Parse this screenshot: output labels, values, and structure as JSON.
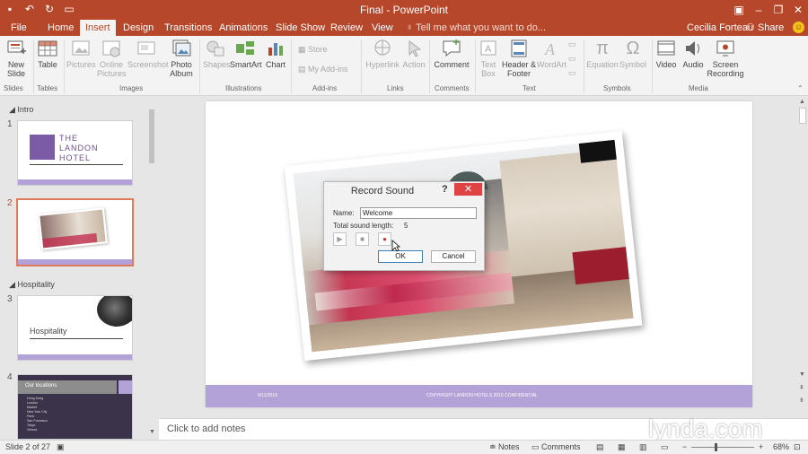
{
  "window": {
    "title": "Final  -  PowerPoint",
    "qat": [
      "save-icon",
      "undo-icon",
      "redo-icon",
      "present-icon"
    ]
  },
  "tabs": {
    "items": [
      "File",
      "Home",
      "Insert",
      "Design",
      "Transitions",
      "Animations",
      "Slide Show",
      "Review",
      "View"
    ],
    "active": "Insert",
    "tell_me": "Tell me what you want to do...",
    "user": "Cecilia Forteau",
    "share": "Share"
  },
  "ribbon": {
    "new_slide": "New Slide",
    "table": "Table",
    "pictures": "Pictures",
    "online_pictures": "Online Pictures",
    "screenshot": "Screenshot",
    "photo_album": "Photo Album",
    "shapes": "Shapes",
    "smartart": "SmartArt",
    "chart": "Chart",
    "store": "Store",
    "my_addins": "My Add-ins",
    "hyperlink": "Hyperlink",
    "action": "Action",
    "comment": "Comment",
    "text_box": "Text Box",
    "header_footer": "Header & Footer",
    "wordart": "WordArt",
    "equation": "Equation",
    "symbol": "Symbol",
    "video": "Video",
    "audio": "Audio",
    "screen_recording": "Screen Recording",
    "groups": {
      "slides": "Slides",
      "tables": "Tables",
      "images": "Images",
      "illustrations": "Illustrations",
      "addins": "Add-ins",
      "links": "Links",
      "comments": "Comments",
      "text": "Text",
      "symbols": "Symbols",
      "media": "Media"
    }
  },
  "thumbnails": {
    "sections": [
      "Intro",
      "Hospitality"
    ],
    "slides": [
      {
        "num": "1",
        "line1": "THE",
        "line2": "LANDON",
        "line3": "HOTEL"
      },
      {
        "num": "2"
      },
      {
        "num": "3",
        "title": "Hospitality"
      },
      {
        "num": "4",
        "title": "Our locations",
        "items": [
          "Hong Kong",
          "London",
          "Madrid",
          "New York City",
          "Paris",
          "San Francisco",
          "Tokyo",
          "Vienna"
        ]
      }
    ]
  },
  "slide": {
    "footer_date": "4/11/2016",
    "footer_text": "COPYRIGHT LANDON HOTELS 2016 CONFIDENTIAL"
  },
  "dialog": {
    "title": "Record Sound",
    "help": "?",
    "close": "✕",
    "name_label": "Name:",
    "name_value": "Welcome",
    "length_label": "Total sound length:",
    "length_value": "5",
    "ok": "OK",
    "cancel": "Cancel"
  },
  "notes": {
    "placeholder": "Click to add notes"
  },
  "status": {
    "slide_info": "Slide 2 of 27",
    "notes": "Notes",
    "comments": "Comments",
    "zoom": "68%"
  },
  "watermark": "lynda.com"
}
